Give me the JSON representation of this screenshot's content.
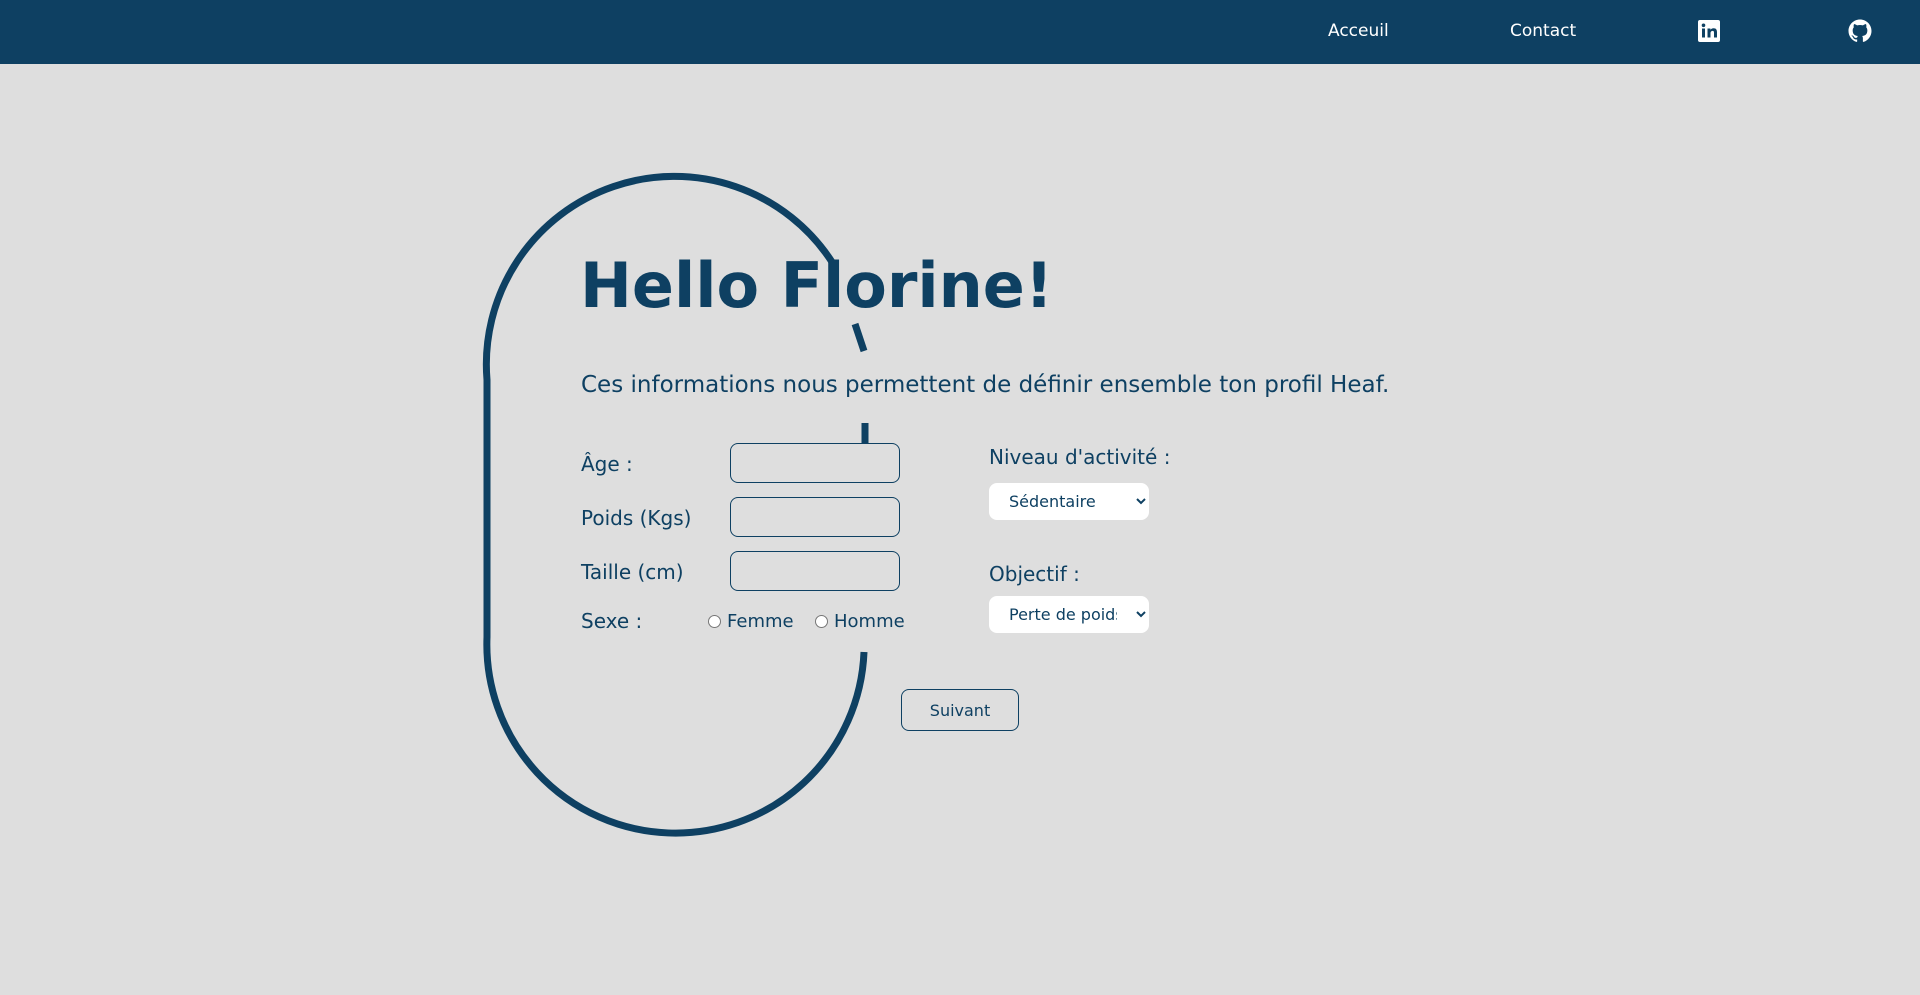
{
  "nav": {
    "home_label": "Acceuil",
    "contact_label": "Contact",
    "linkedin_icon": "linkedin-icon",
    "github_icon": "github-icon"
  },
  "colors": {
    "primary": "#0e4062",
    "background": "#dedede",
    "white": "#ffffff"
  },
  "hero": {
    "title": "Hello Florine!",
    "subtitle": "Ces informations nous permettent de définir ensemble ton profil Heaf."
  },
  "form": {
    "age_label": "Âge :",
    "age_value": "",
    "weight_label": "Poids (Kgs)",
    "weight_value": "",
    "height_label": "Taille (cm)",
    "height_value": "",
    "sex_label": "Sexe :",
    "sex_options": [
      "Femme",
      "Homme"
    ],
    "activity_label": "Niveau d'activité :",
    "activity_selected": "Sédentaire",
    "goal_label": "Objectif :",
    "goal_selected": "Perte de poids",
    "next_label": "Suivant"
  }
}
